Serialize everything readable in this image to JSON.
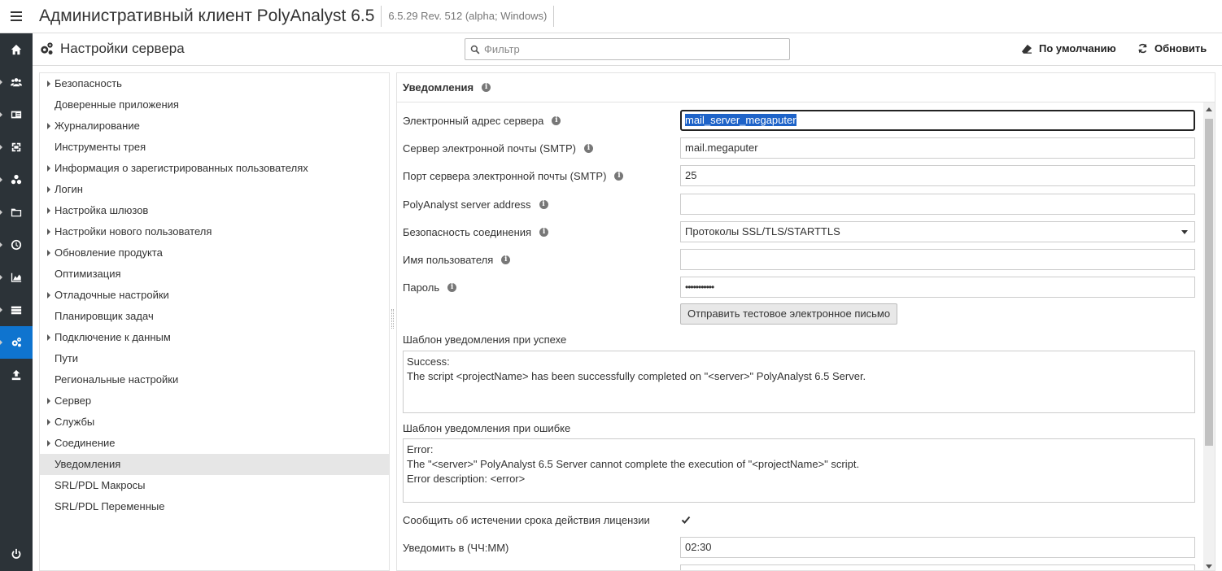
{
  "app": {
    "title": "Административный клиент PolyAnalyst 6.5",
    "version": "6.5.29 Rev. 512 (alpha; Windows)"
  },
  "rail": {
    "icons": [
      "home-icon",
      "users-icon",
      "id-card-icon",
      "scan-icon",
      "nodes-icon",
      "folder-icon",
      "clock-icon",
      "chart-icon",
      "server-icon",
      "cogs-icon",
      "upload-icon",
      "power-icon"
    ],
    "active": "cogs-icon"
  },
  "header": {
    "page_title": "Настройки сервера",
    "filter_placeholder": "Фильтр",
    "defaults_label": "По умолчанию",
    "refresh_label": "Обновить"
  },
  "tree": {
    "items": [
      {
        "label": "Безопасность",
        "expandable": true
      },
      {
        "label": "Доверенные приложения",
        "expandable": false
      },
      {
        "label": "Журналирование",
        "expandable": true
      },
      {
        "label": "Инструменты трея",
        "expandable": false
      },
      {
        "label": "Информация о зарегистрированных пользователях",
        "expandable": true
      },
      {
        "label": "Логин",
        "expandable": true
      },
      {
        "label": "Настройка шлюзов",
        "expandable": true
      },
      {
        "label": "Настройки нового пользователя",
        "expandable": true
      },
      {
        "label": "Обновление продукта",
        "expandable": true
      },
      {
        "label": "Оптимизация",
        "expandable": false
      },
      {
        "label": "Отладочные настройки",
        "expandable": true
      },
      {
        "label": "Планировщик задач",
        "expandable": false
      },
      {
        "label": "Подключение к данным",
        "expandable": true
      },
      {
        "label": "Пути",
        "expandable": false
      },
      {
        "label": "Региональные настройки",
        "expandable": false
      },
      {
        "label": "Сервер",
        "expandable": true
      },
      {
        "label": "Службы",
        "expandable": true
      },
      {
        "label": "Соединение",
        "expandable": true
      },
      {
        "label": "Уведомления",
        "expandable": false,
        "selected": true
      },
      {
        "label": "SRL/PDL Макросы",
        "expandable": false
      },
      {
        "label": "SRL/PDL Переменные",
        "expandable": false
      }
    ]
  },
  "panel": {
    "title": "Уведомления",
    "server_email_label": "Электронный адрес сервера",
    "server_email_value": "mail_server_megaputer",
    "smtp_label": "Сервер электронной почты (SMTP)",
    "smtp_value": "mail.megaputer",
    "smtp_port_label": "Порт сервера электронной почты (SMTP)",
    "smtp_port_value": "25",
    "pa_address_label": "PolyAnalyst server address",
    "pa_address_value": "",
    "security_label": "Безопасность соединения",
    "security_value": "Протоколы SSL/TLS/STARTTLS",
    "username_label": "Имя пользователя",
    "username_value": "",
    "password_label": "Пароль",
    "password_value": "•••••••••••",
    "send_test_label": "Отправить тестовое электронное письмо",
    "success_template_label": "Шаблон уведомления при успехе",
    "success_template_value": "Success:\nThe script <projectName> has been successfully completed on \"<server>\" PolyAnalyst 6.5 Server.",
    "error_template_label": "Шаблон уведомления при ошибке",
    "error_template_value": "Error:\nThe \"<server>\" PolyAnalyst 6.5 Server cannot complete the execution of \"<projectName>\" script.\nError description: <error>",
    "license_expiry_label": "Сообщить об истечении срока действия лицензии",
    "license_expiry_checked": true,
    "notify_time_label": "Уведомить в (ЧЧ:ММ)",
    "notify_time_value": "02:30"
  }
}
